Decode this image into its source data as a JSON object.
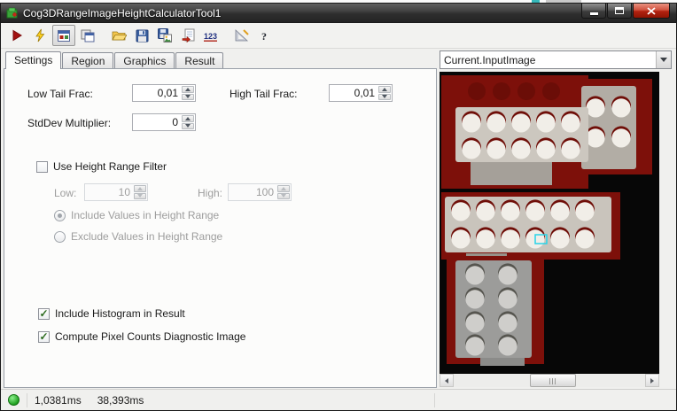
{
  "window": {
    "title": "Cog3DRangeImageHeightCalculatorTool1"
  },
  "toolbar": {
    "icons": [
      "run-icon",
      "electric-run-icon",
      "show-image-display-icon",
      "copy-records-icon",
      "open-file-icon",
      "save-icon",
      "save-image-icon",
      "import-icon",
      "number-display-icon",
      "calibration-icon",
      "help-icon"
    ]
  },
  "tabs": {
    "settings": "Settings",
    "region": "Region",
    "graphics": "Graphics",
    "result": "Result"
  },
  "settings_tab": {
    "low_tail_label": "Low Tail Frac:",
    "low_tail_value": "0,01",
    "high_tail_label": "High Tail Frac:",
    "high_tail_value": "0,01",
    "stddev_label": "StdDev Multiplier:",
    "stddev_value": "0",
    "height_filter_label": "Use Height Range Filter",
    "height_filter_checked": false,
    "low_label": "Low:",
    "low_value": "10",
    "high_label": "High:",
    "high_value": "100",
    "include_radio_label": "Include Values in Height Range",
    "include_radio_selected": true,
    "exclude_radio_label": "Exclude Values in Height Range",
    "exclude_radio_selected": false,
    "histogram_label": "Include Histogram in Result",
    "histogram_checked": true,
    "pixel_counts_label": "Compute Pixel Counts Diagnostic Image",
    "pixel_counts_checked": true
  },
  "image_panel": {
    "selected_image": "Current.InputImage"
  },
  "status_bar": {
    "run_time": "1,0381ms",
    "total_time": "38,393ms"
  },
  "colors": {
    "status_green": "#20a020",
    "close_button_red": "#b12210",
    "range_image_red": "#7d100a",
    "selection_cyan": "#28d4e8",
    "run_icon_red": "#a31111",
    "electric_icon_yellow": "#ffd21f"
  }
}
